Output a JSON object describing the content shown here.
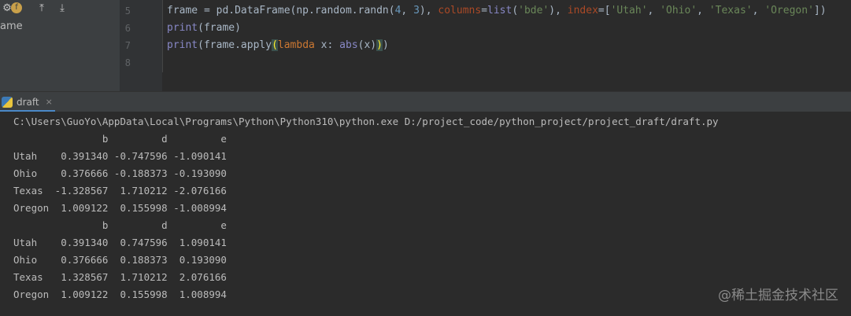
{
  "left_panel": {
    "toolbar_icons": [
      "gear-icon",
      "python-file-icon",
      "collapse-up-icon",
      "expand-down-icon"
    ],
    "tree_label": "ame"
  },
  "editor": {
    "line_numbers": [
      "5",
      "6",
      "7",
      "8"
    ],
    "code": [
      "frame = pd.DataFrame(np.random.randn(4, 3), columns=list('bde'), index=['Utah', 'Ohio', 'Texas', 'Oregon'])",
      "print(frame)",
      "print(frame.apply(lambda x: abs(x)))",
      ""
    ]
  },
  "run_window": {
    "tab_label": "draft",
    "close_glyph": "×"
  },
  "console": {
    "lines": [
      "C:\\Users\\GuoYo\\AppData\\Local\\Programs\\Python\\Python310\\python.exe D:/project_code/python_project/project_draft/draft.py",
      "               b         d         e",
      "Utah    0.391340 -0.747596 -1.090141",
      "Ohio    0.376666 -0.188373 -0.193090",
      "Texas  -1.328567  1.710212 -2.076166",
      "Oregon  1.009122  0.155998 -1.008994",
      "               b         d         e",
      "Utah    0.391340  0.747596  1.090141",
      "Ohio    0.376666  0.188373  0.193090",
      "Texas   1.328567  1.710212  2.076166",
      "Oregon  1.009122  0.155998  1.008994"
    ]
  },
  "watermark": "@稀土掘金技术社区"
}
